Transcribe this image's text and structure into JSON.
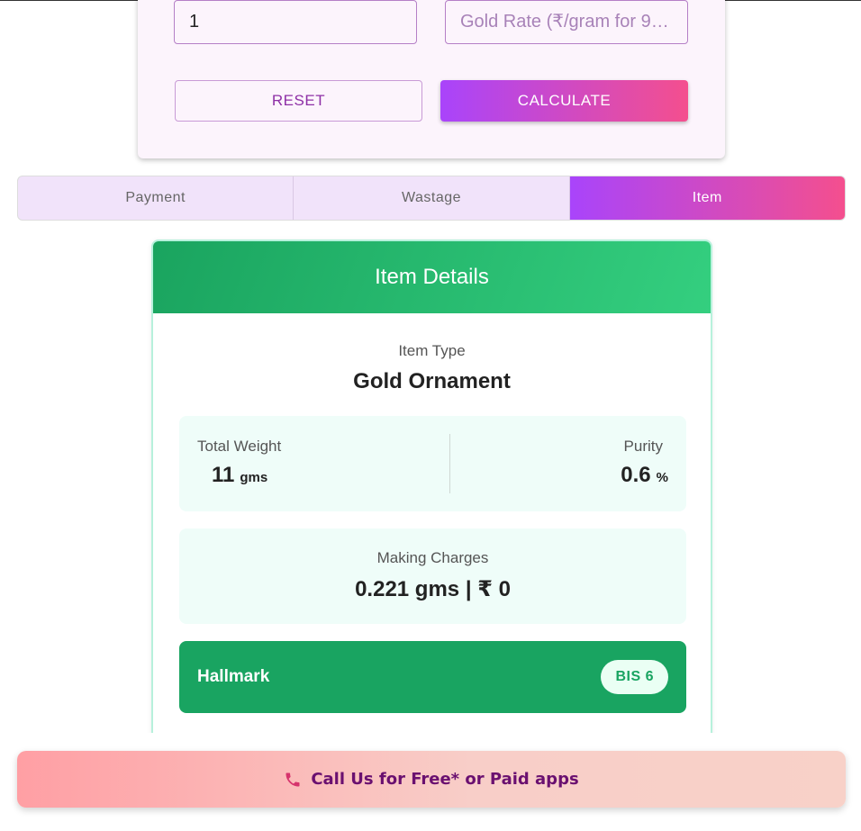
{
  "calculator": {
    "quantity_value": "1",
    "rate_placeholder": "Gold Rate (₹/gram for 9…",
    "reset_label": "RESET",
    "calculate_label": "CALCULATE"
  },
  "tabs": [
    {
      "label": "Payment",
      "active": false
    },
    {
      "label": "Wastage",
      "active": false
    },
    {
      "label": "Item",
      "active": true
    }
  ],
  "item_details": {
    "title": "Item Details",
    "item_type_label": "Item Type",
    "item_type_value": "Gold Ornament",
    "total_weight_label": "Total Weight",
    "total_weight_value": "11",
    "total_weight_unit": "gms",
    "purity_label": "Purity",
    "purity_value": "0.6",
    "purity_unit": "%",
    "making_charges_label": "Making Charges",
    "making_charges_value": "0.221 gms | ₹ 0",
    "hallmark_label": "Hallmark",
    "hallmark_badge": "BIS 6"
  },
  "footer": {
    "call_label": "Call Us for Free* or Paid apps",
    "call_icon": "phone-icon"
  },
  "colors": {
    "accent_gradient_start": "#a944fb",
    "accent_gradient_end": "#f44f8e",
    "green": "#19a461"
  }
}
